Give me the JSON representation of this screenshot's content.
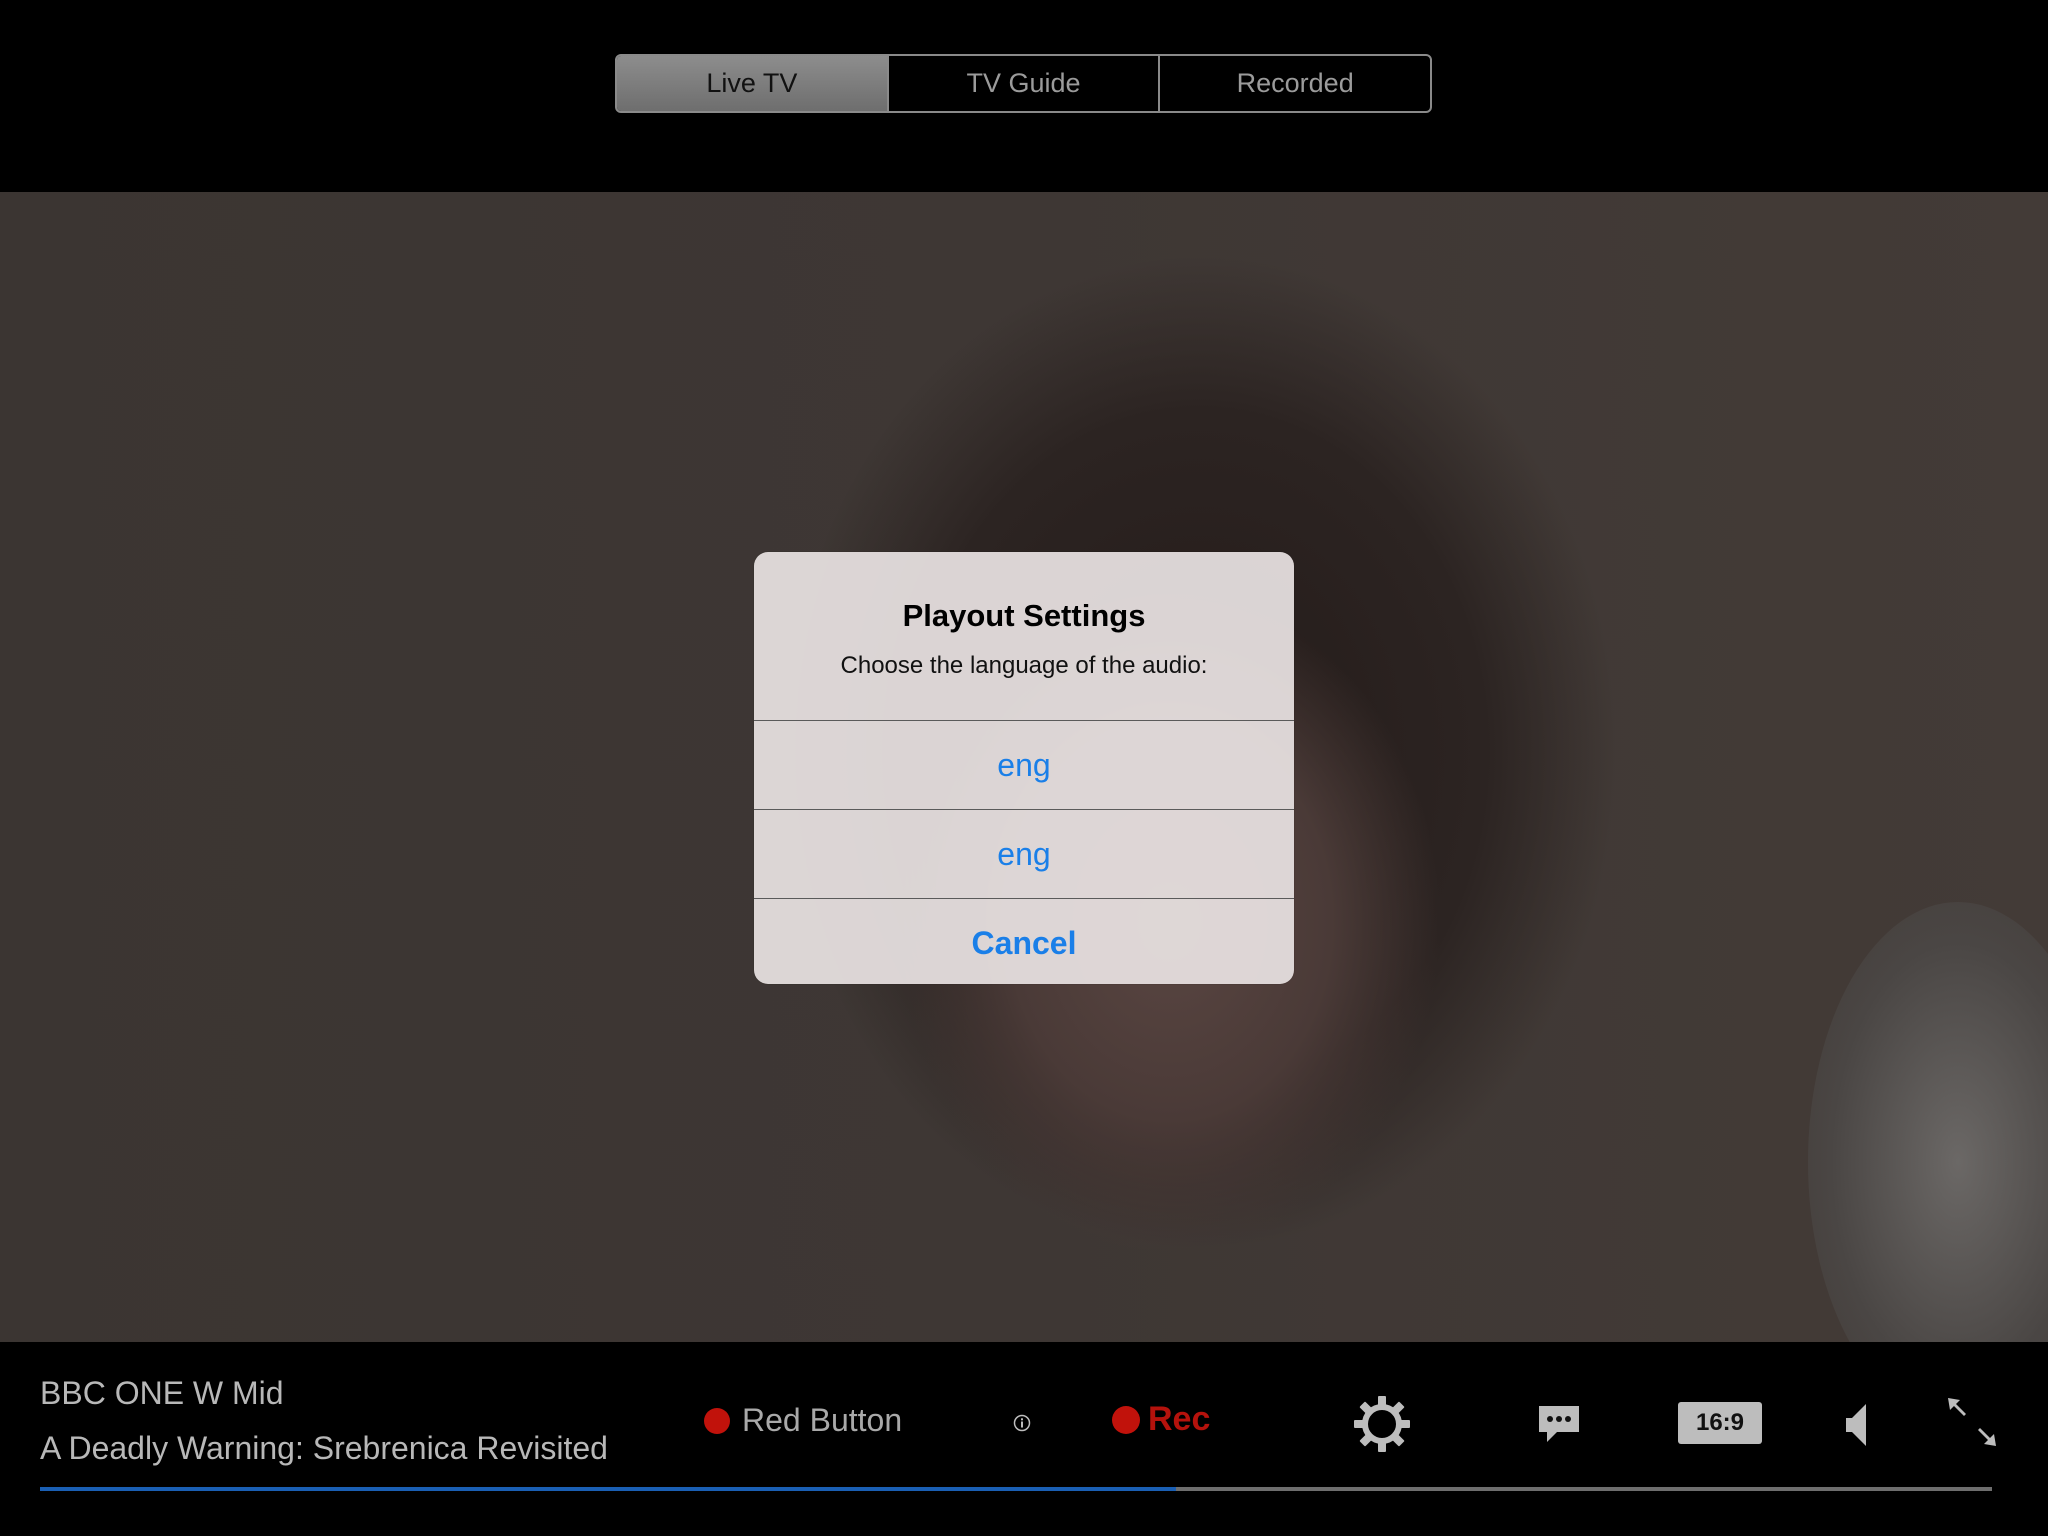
{
  "tabs": [
    {
      "label": "Live TV",
      "active": true
    },
    {
      "label": "TV Guide",
      "active": false
    },
    {
      "label": "Recorded",
      "active": false
    }
  ],
  "dialog": {
    "title": "Playout Settings",
    "message": "Choose the language of the audio:",
    "options": [
      "eng",
      "eng"
    ],
    "cancel_label": "Cancel"
  },
  "bar": {
    "channel": "BBC ONE W Mid",
    "programme": "A Deadly Warning: Srebrenica Revisited",
    "red_button_label": "Red Button",
    "rec_label": "Rec",
    "aspect_label": "16:9",
    "progress_fraction": 0.582
  },
  "colors": {
    "accent_blue": "#1a7fe8",
    "record_red": "#c1120b",
    "progress_blue": "#1a5fb4"
  },
  "icons": [
    "info-icon",
    "gear-icon",
    "subtitles-icon",
    "volume-icon",
    "fullscreen-icon"
  ]
}
